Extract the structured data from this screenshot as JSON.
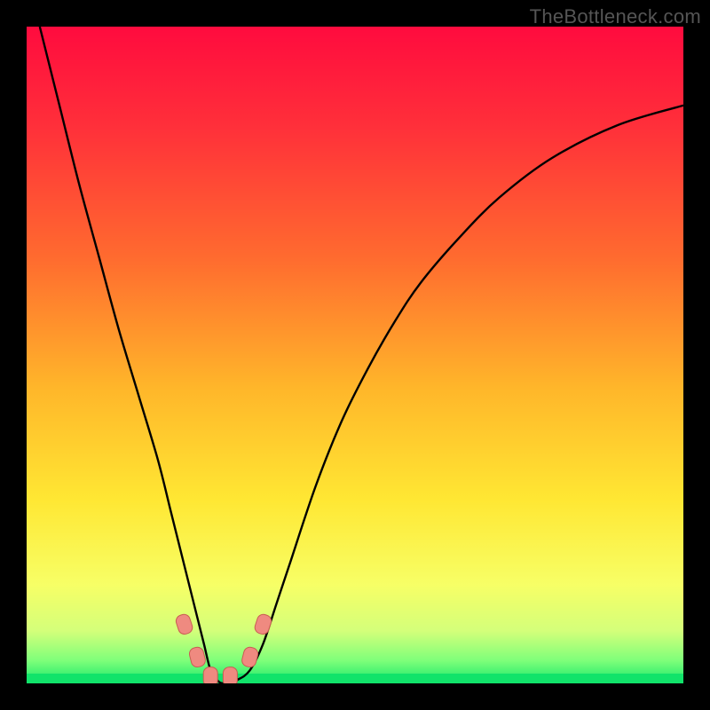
{
  "watermark": "TheBottleneck.com",
  "chart_data": {
    "type": "line",
    "title": "",
    "xlabel": "",
    "ylabel": "",
    "xlim": [
      0,
      100
    ],
    "ylim": [
      0,
      100
    ],
    "grid": false,
    "series": [
      {
        "name": "curve",
        "x": [
          2,
          5,
          8,
          11,
          14,
          17,
          20,
          22,
          24,
          26,
          27,
          28,
          29,
          30,
          32,
          34,
          36,
          38,
          40,
          44,
          48,
          52,
          56,
          60,
          66,
          72,
          80,
          90,
          100
        ],
        "y": [
          100,
          88,
          76,
          65,
          54,
          44,
          34,
          26,
          18,
          10,
          6,
          2,
          0.5,
          0,
          0.5,
          2,
          6,
          12,
          18,
          30,
          40,
          48,
          55,
          61,
          68,
          74,
          80,
          85,
          88
        ]
      }
    ],
    "markers": [
      {
        "x": 24,
        "y": 9,
        "name": "marker-left-upper"
      },
      {
        "x": 26,
        "y": 4,
        "name": "marker-left-lower"
      },
      {
        "x": 28,
        "y": 1,
        "name": "marker-bottom-left"
      },
      {
        "x": 31,
        "y": 1,
        "name": "marker-bottom-right"
      },
      {
        "x": 34,
        "y": 4,
        "name": "marker-right-lower"
      },
      {
        "x": 36,
        "y": 9,
        "name": "marker-right-upper"
      }
    ],
    "background_gradient": {
      "stops": [
        {
          "offset": 0.0,
          "color": "#ff0b3e"
        },
        {
          "offset": 0.15,
          "color": "#ff2f3a"
        },
        {
          "offset": 0.35,
          "color": "#ff6a2f"
        },
        {
          "offset": 0.55,
          "color": "#ffb62a"
        },
        {
          "offset": 0.72,
          "color": "#ffe733"
        },
        {
          "offset": 0.85,
          "color": "#f7ff66"
        },
        {
          "offset": 0.92,
          "color": "#d4ff7a"
        },
        {
          "offset": 0.965,
          "color": "#7fff7a"
        },
        {
          "offset": 1.0,
          "color": "#17e86b"
        }
      ]
    },
    "bottom_band_color": "#11e36a",
    "curve_color": "#000000",
    "marker_fill": "#ef8a80",
    "marker_stroke": "#c95c52"
  }
}
